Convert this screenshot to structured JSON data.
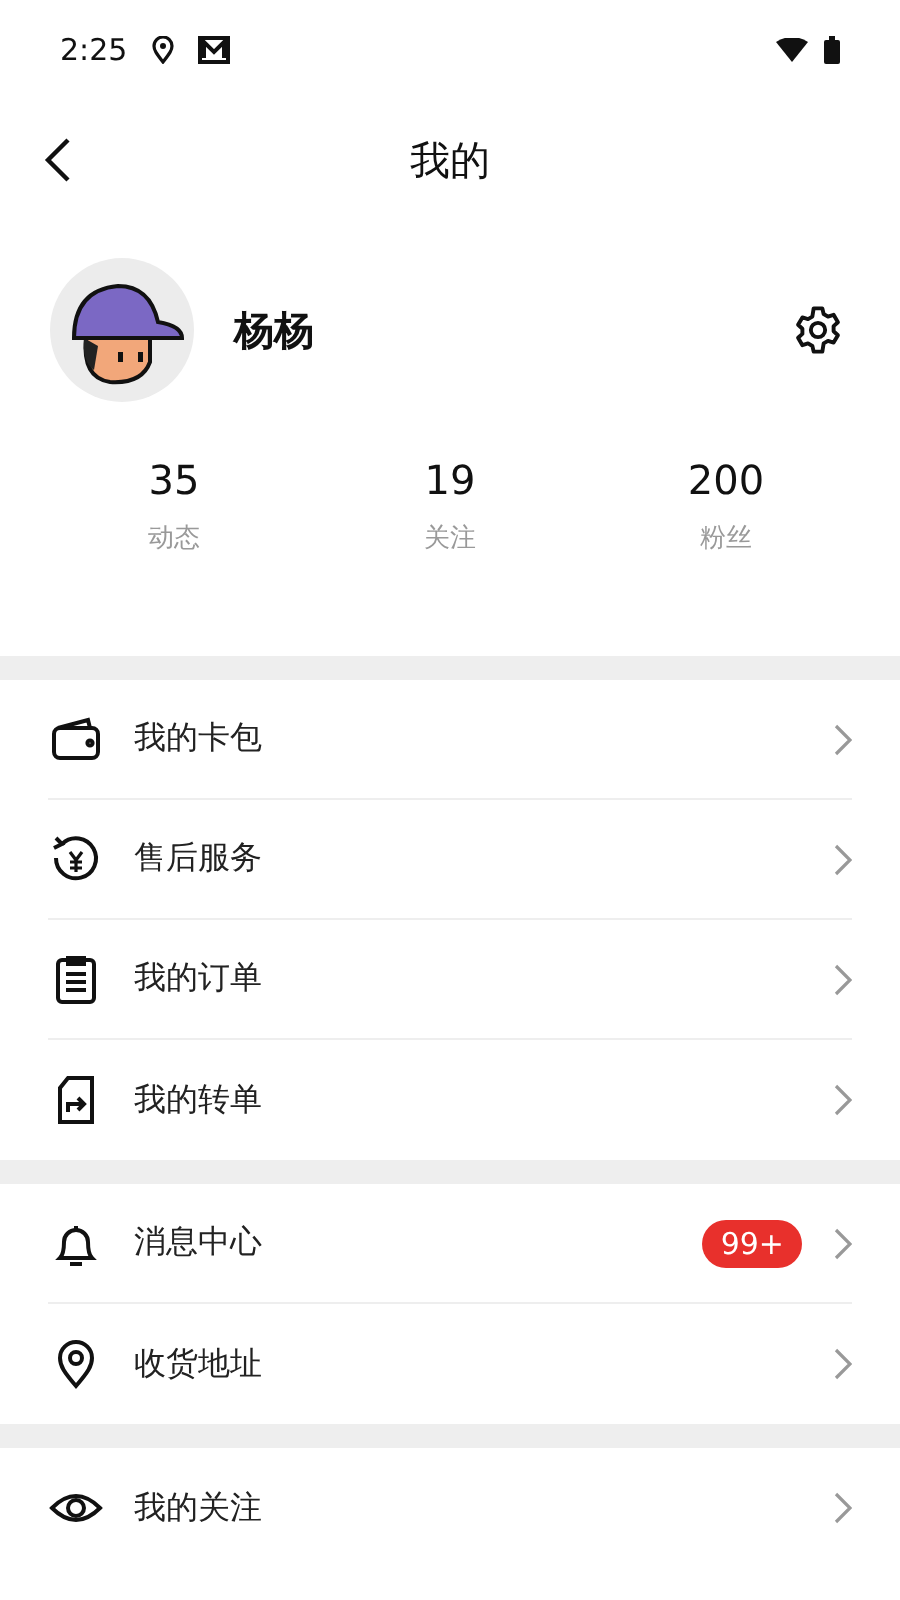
{
  "status_bar": {
    "time": "2:25"
  },
  "header": {
    "title": "我的"
  },
  "profile": {
    "name": "杨杨"
  },
  "stats": [
    {
      "value": "35",
      "label": "动态"
    },
    {
      "value": "19",
      "label": "关注"
    },
    {
      "value": "200",
      "label": "粉丝"
    }
  ],
  "menu_groups": [
    [
      {
        "kind": "wallet",
        "label": "我的卡包"
      },
      {
        "kind": "refund",
        "label": "售后服务"
      },
      {
        "kind": "clipboard",
        "label": "我的订单"
      },
      {
        "kind": "transfer",
        "label": "我的转单"
      }
    ],
    [
      {
        "kind": "bell",
        "label": "消息中心",
        "badge": "99+"
      },
      {
        "kind": "pin",
        "label": "收货地址"
      }
    ],
    [
      {
        "kind": "eye",
        "label": "我的关注"
      }
    ]
  ]
}
